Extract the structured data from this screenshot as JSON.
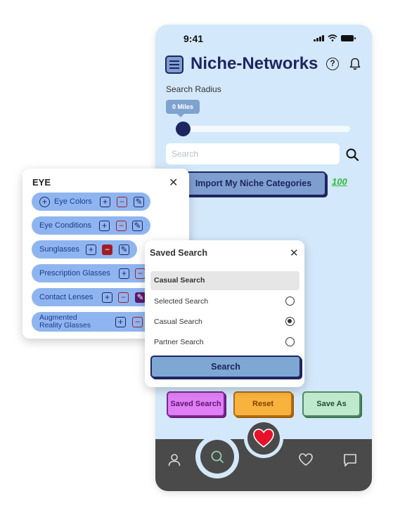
{
  "status_bar": {
    "time": "9:41"
  },
  "header": {
    "title": "Niche-Networks",
    "help_icon_glyph": "?"
  },
  "search_radius": {
    "label": "Search Radius",
    "value_label": "0 Miles",
    "value_fraction": 0.0
  },
  "search": {
    "placeholder": "Search"
  },
  "import_button": {
    "label": "Import My Niche Categories"
  },
  "badge": {
    "text": "100"
  },
  "action_buttons": {
    "saved_search": "Saved Search",
    "reset": "Reset",
    "save_as": "Save As"
  },
  "eye_panel": {
    "title": "EYE",
    "items": [
      {
        "label": "Eye Colors"
      },
      {
        "label": "Eye Conditions"
      },
      {
        "label": "Sunglasses"
      },
      {
        "label": "Prescription Glasses"
      },
      {
        "label": "Contact Lenses"
      },
      {
        "label": "Augmented Reality Glasses"
      }
    ]
  },
  "saved_search_modal": {
    "title": "Saved Search",
    "selected_value": "Casual Search",
    "options_header": "Selected Search",
    "options": [
      {
        "label": "Casual Search",
        "checked": true
      },
      {
        "label": "Partner Search",
        "checked": false
      }
    ],
    "search_button": "Search"
  },
  "colors": {
    "accent": "#1d2660",
    "app_background": "#d3e8fa",
    "nav_background": "#4a4a4a",
    "heart": "#e8102a"
  },
  "icons": {
    "menu": "menu-icon",
    "help": "help-icon",
    "bell": "bell-icon",
    "search": "search-icon",
    "profile": "user-icon",
    "favorites": "heart-outline-icon",
    "messages": "chat-icon"
  }
}
